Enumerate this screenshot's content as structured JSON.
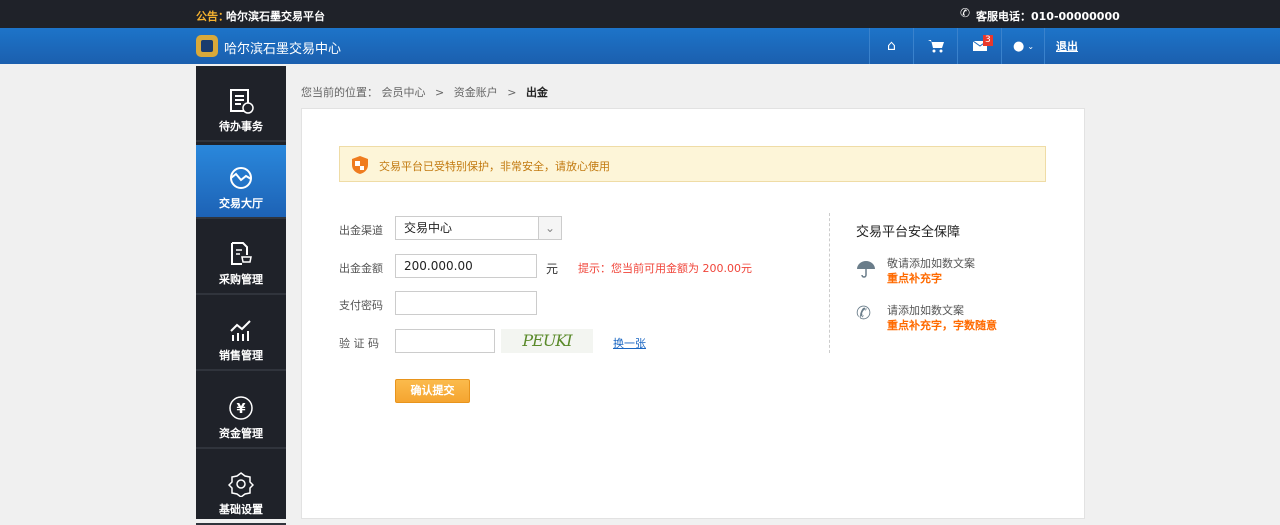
{
  "topbar": {
    "notice_label": "公告：",
    "notice_text": "哈尔滨石墨交易平台",
    "service_phone": "客服电话：010-00000000"
  },
  "navbar": {
    "title": "哈尔滨石墨交易中心",
    "mail_count": "3",
    "logout": "退出"
  },
  "sidebar": {
    "items": [
      {
        "label": "待办事务"
      },
      {
        "label": "交易大厅"
      },
      {
        "label": "采购管理"
      },
      {
        "label": "销售管理"
      },
      {
        "label": "资金管理"
      },
      {
        "label": "基础设置"
      }
    ]
  },
  "breadcrumb": {
    "prefix": "您当前的位置：",
    "items": [
      "会员中心",
      "资金账户",
      "出金"
    ],
    "sep": ">"
  },
  "alert": {
    "text": "交易平台已受特别保护，非常安全，请放心使用"
  },
  "form": {
    "channel_label": "出金渠道",
    "channel_value": "交易中心",
    "amount_label": "出金金额",
    "amount_value": "200.000.00",
    "unit": "元",
    "hint": "提示：您当前可用金额为 200.00元",
    "password_label": "支付密码",
    "password_value": "",
    "captcha_label": "验 证 码",
    "captcha_value": "",
    "captcha_image_text": "PEUKI",
    "refresh": "换一张",
    "submit": "确认提交"
  },
  "security": {
    "title": "交易平台安全保障",
    "items": [
      {
        "text": "敬请添加如数文案",
        "highlight": "重点补充字"
      },
      {
        "text": "请添加如数文案",
        "highlight": "重点补充字，字数随意"
      }
    ]
  },
  "colors": {
    "accent": "#1d6fc3",
    "warning": "#ff6a00",
    "hint": "#f0453a",
    "button": "#f7a93a"
  }
}
